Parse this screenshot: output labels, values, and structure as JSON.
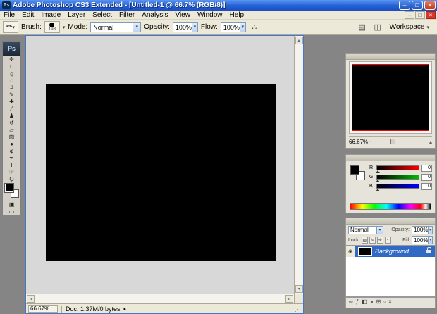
{
  "colors": {
    "foreground": "#000000",
    "background": "#ffffff",
    "selection_blue": "#316AC5",
    "navigator_proxy_border": "#ff0000",
    "canvas_image": "#000000"
  },
  "window": {
    "app_icon": "Ps",
    "title": "Adobe Photoshop CS3 Extended - [Untitled-1 @ 66.7% (RGB/8)]",
    "minimize_icon": "–",
    "maximize_icon": "□",
    "close_icon": "×"
  },
  "menu": {
    "items": [
      "File",
      "Edit",
      "Image",
      "Layer",
      "Select",
      "Filter",
      "Analysis",
      "View",
      "Window",
      "Help"
    ],
    "doc_minimize_icon": "–",
    "doc_restore_icon": "□",
    "doc_close_icon": "×"
  },
  "options": {
    "tool_preset_icon": "✏",
    "dropdown_icon": "▾",
    "brush_label": "Brush:",
    "brush_size": "198",
    "mode_label": "Mode:",
    "mode_value": "Normal",
    "opacity_label": "Opacity:",
    "opacity_value": "100%",
    "flow_label": "Flow:",
    "flow_value": "100%",
    "airbrush_icon": "∴",
    "palette_well_icon": "▤",
    "bridge_icon": "◫",
    "workspace_button": "Workspace",
    "workspace_arrow": "▾"
  },
  "toolbox": {
    "logo": "Ps",
    "tools": [
      {
        "name": "move",
        "glyph": "✛"
      },
      {
        "name": "rectangular-marquee",
        "glyph": "□"
      },
      {
        "name": "lasso",
        "glyph": "ϱ"
      },
      {
        "name": "quick-selection",
        "glyph": "◌"
      },
      {
        "name": "crop",
        "glyph": "#"
      },
      {
        "name": "eyedropper",
        "glyph": "✎"
      },
      {
        "name": "healing-brush",
        "glyph": "✚"
      },
      {
        "name": "brush",
        "glyph": "⁄"
      },
      {
        "name": "clone-stamp",
        "glyph": "♟"
      },
      {
        "name": "history-brush",
        "glyph": "↺"
      },
      {
        "name": "eraser",
        "glyph": "▱"
      },
      {
        "name": "gradient",
        "glyph": "▨"
      },
      {
        "name": "blur",
        "glyph": "●"
      },
      {
        "name": "dodge",
        "glyph": "φ"
      },
      {
        "name": "pen",
        "glyph": "✒"
      },
      {
        "name": "type",
        "glyph": "T"
      },
      {
        "name": "hand",
        "glyph": "☞"
      },
      {
        "name": "zoom",
        "glyph": "Ǫ"
      }
    ],
    "quick_mask_icon": "▣",
    "screen_mode_icon": "▭"
  },
  "document": {
    "status_zoom": "66.67%",
    "status_doc": "Doc: 1.37M/0 bytes",
    "status_arrow": "▸",
    "scroll_up_icon": "▴",
    "scroll_down_icon": "▾",
    "scroll_left_icon": "◂",
    "scroll_right_icon": "▸",
    "resize_grip_icon": "⋰"
  },
  "navigator": {
    "zoom": "66.67%",
    "zoom_out_icon": "▴",
    "zoom_in_icon": "▴"
  },
  "color_panel": {
    "channels": [
      {
        "label": "R",
        "value": "0"
      },
      {
        "label": "G",
        "value": "0"
      },
      {
        "label": "B",
        "value": "0"
      }
    ]
  },
  "layers": {
    "blend_mode": "Normal",
    "opacity_label": "Opacity:",
    "opacity_value": "100%",
    "lock_label": "Lock:",
    "lock_icons": [
      "▨",
      "✎",
      "✛",
      "▪"
    ],
    "fill_label": "Fill:",
    "fill_value": "100%",
    "rows": [
      {
        "name": "Background",
        "eye_icon": "◉"
      }
    ],
    "bottom_icons": [
      "∞",
      "ƒ",
      "◧",
      "◑",
      "⊞",
      "▫",
      "×"
    ]
  }
}
